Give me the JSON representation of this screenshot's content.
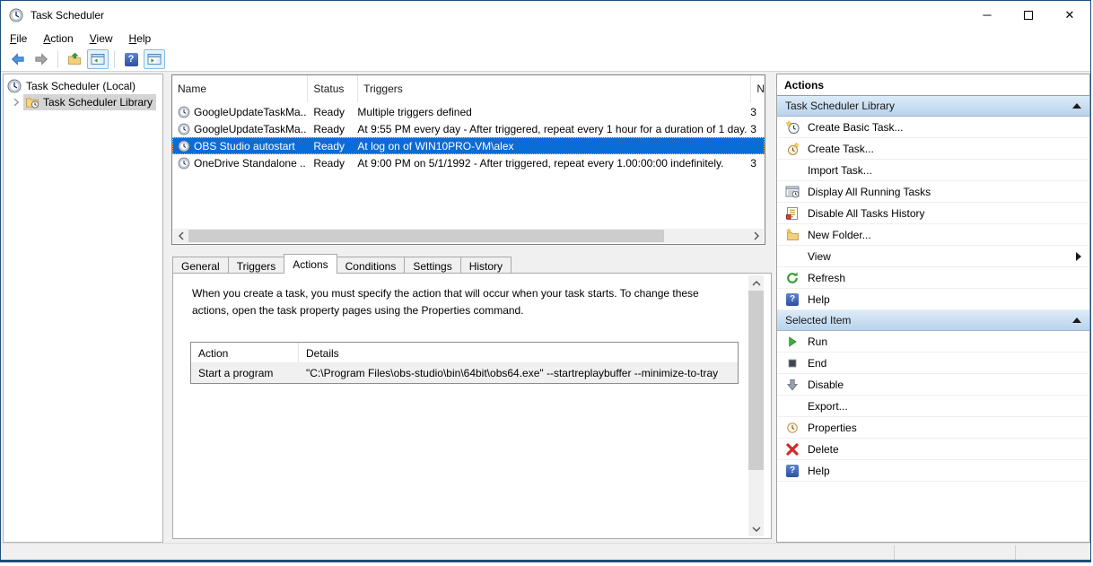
{
  "window": {
    "title": "Task Scheduler",
    "minimize_glyph": "─",
    "close_glyph": "✕"
  },
  "menu": {
    "items": [
      {
        "first": "F",
        "rest": "ile"
      },
      {
        "first": "A",
        "rest": "ction"
      },
      {
        "first": "V",
        "rest": "iew"
      },
      {
        "first": "H",
        "rest": "elp"
      }
    ]
  },
  "toolbar": {
    "icons": [
      "back-arrow",
      "forward-arrow",
      "export-folder",
      "show-console-tree",
      "help",
      "show-action-pane"
    ]
  },
  "tree": {
    "root_label": "Task Scheduler (Local)",
    "library_label": "Task Scheduler Library"
  },
  "task_list": {
    "columns": {
      "name": "Name",
      "status": "Status",
      "triggers": "Triggers",
      "next_partial": "N"
    },
    "rows": [
      {
        "name": "GoogleUpdateTaskMa...",
        "status": "Ready",
        "triggers": "Multiple triggers defined",
        "next": "3"
      },
      {
        "name": "GoogleUpdateTaskMa...",
        "status": "Ready",
        "triggers": "At 9:55 PM every day - After triggered, repeat every 1 hour for a duration of 1 day.",
        "next": "3"
      },
      {
        "name": "OBS Studio autostart",
        "status": "Ready",
        "triggers": "At log on of WIN10PRO-VM\\alex",
        "next": ""
      },
      {
        "name": "OneDrive Standalone ...",
        "status": "Ready",
        "triggers": "At 9:00 PM on 5/1/1992 - After triggered, repeat every 1.00:00:00 indefinitely.",
        "next": "3"
      }
    ]
  },
  "tabs": {
    "active": "Actions",
    "items": [
      {
        "label": "General"
      },
      {
        "label": "Triggers"
      },
      {
        "label": "Actions"
      },
      {
        "label": "Conditions"
      },
      {
        "label": "Settings"
      },
      {
        "label": "History"
      }
    ]
  },
  "actions_tab": {
    "description": "When you create a task, you must specify the action that will occur when your task starts.  To change these actions, open the task property pages using the Properties command.",
    "table": {
      "action_col": "Action",
      "details_col": "Details",
      "rows": [
        {
          "action": "Start a program",
          "details": "\"C:\\Program Files\\obs-studio\\bin\\64bit\\obs64.exe\" --startreplaybuffer --minimize-to-tray"
        }
      ]
    }
  },
  "actions_panel": {
    "title": "Actions",
    "sections": [
      {
        "header": "Task Scheduler Library",
        "items": [
          {
            "label": "Create Basic Task...",
            "icon": "create-basic-task-icon"
          },
          {
            "label": "Create Task...",
            "icon": "create-task-icon"
          },
          {
            "label": "Import Task...",
            "icon": ""
          },
          {
            "label": "Display All Running Tasks",
            "icon": "running-tasks-icon"
          },
          {
            "label": "Disable All Tasks History",
            "icon": "tasks-history-icon"
          },
          {
            "label": "New Folder...",
            "icon": "new-folder-icon"
          },
          {
            "label": "View",
            "icon": "",
            "submenu": true
          },
          {
            "label": "Refresh",
            "icon": "refresh-icon"
          },
          {
            "label": "Help",
            "icon": "help-icon"
          }
        ]
      },
      {
        "header": "Selected Item",
        "items": [
          {
            "label": "Run",
            "icon": "run-icon"
          },
          {
            "label": "End",
            "icon": "end-icon"
          },
          {
            "label": "Disable",
            "icon": "disable-icon"
          },
          {
            "label": "Export...",
            "icon": ""
          },
          {
            "label": "Properties",
            "icon": "properties-icon"
          },
          {
            "label": "Delete",
            "icon": "delete-icon"
          },
          {
            "label": "Help",
            "icon": "help-icon"
          }
        ]
      }
    ]
  },
  "icons": {
    "help_glyph": "?"
  },
  "colors": {
    "selection": "#0a6cd6",
    "window_border": "#1f4e79",
    "section_header": "#b9d3ec",
    "tree_selection": "#d4d4d4"
  }
}
